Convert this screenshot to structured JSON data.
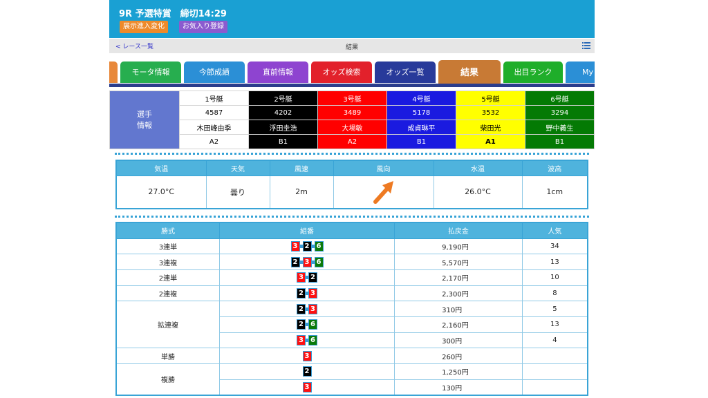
{
  "header": {
    "title": "9R 予選特賞　締切14:29",
    "btn_change": "展示進入変化",
    "btn_favorite": "お気入り登録"
  },
  "subheader": {
    "back": "< レース一覧",
    "center": "結果"
  },
  "tabs": [
    {
      "label": "",
      "color": "#e8883a"
    },
    {
      "label": "モータ情報",
      "color": "#27ae4f"
    },
    {
      "label": "今節成績",
      "color": "#2b8fd6"
    },
    {
      "label": "直前情報",
      "color": "#8e44d0"
    },
    {
      "label": "オッズ検索",
      "color": "#e2212b"
    },
    {
      "label": "オッズ一覧",
      "color": "#283a9a"
    },
    {
      "label": "結果",
      "color": "#c87a35"
    },
    {
      "label": "出目ランク",
      "color": "#1fae2a"
    },
    {
      "label": "My",
      "color": "#2b8fd6"
    }
  ],
  "players": {
    "label": "選手\n情報",
    "columns": [
      {
        "boat": "1号艇",
        "reg": "4587",
        "name": "木田峰由季",
        "class": "A2",
        "bg": "#ffffff",
        "fg": "#000000"
      },
      {
        "boat": "2号艇",
        "reg": "4202",
        "name": "浮田圭浩",
        "class": "B1",
        "bg": "#000000",
        "fg": "#ffffff"
      },
      {
        "boat": "3号艇",
        "reg": "3489",
        "name": "大場敏",
        "class": "A2",
        "bg": "#ff0000",
        "fg": "#ffffff"
      },
      {
        "boat": "4号艇",
        "reg": "5178",
        "name": "成貞琳平",
        "class": "B1",
        "bg": "#1a1ae0",
        "fg": "#ffffff"
      },
      {
        "boat": "5号艇",
        "reg": "3532",
        "name": "柴田光",
        "class": "A1",
        "bg": "#ffff00",
        "fg": "#000000"
      },
      {
        "boat": "6号艇",
        "reg": "3294",
        "name": "野中義生",
        "class": "B1",
        "bg": "#047a04",
        "fg": "#ffffff"
      }
    ]
  },
  "weather": {
    "headers": [
      "気温",
      "天気",
      "風速",
      "風向",
      "水温",
      "波高"
    ],
    "values": [
      "27.0°C",
      "曇り",
      "2m",
      "",
      "26.0°C",
      "1cm"
    ]
  },
  "results": {
    "headers": [
      "勝式",
      "組番",
      "払戻金",
      "人気"
    ],
    "rows": [
      {
        "type": "3連単",
        "combo": [
          3,
          2,
          6
        ],
        "payout": "9,190円",
        "pop": "34"
      },
      {
        "type": "3連複",
        "combo": [
          2,
          3,
          6
        ],
        "payout": "5,570円",
        "pop": "13"
      },
      {
        "type": "2連単",
        "combo": [
          3,
          2
        ],
        "payout": "2,170円",
        "pop": "10"
      },
      {
        "type": "2連複",
        "combo": [
          2,
          3
        ],
        "payout": "2,300円",
        "pop": "8"
      },
      {
        "type": "拡連複",
        "combo": [
          2,
          3
        ],
        "payout": "310円",
        "pop": "5"
      },
      {
        "type": "",
        "combo": [
          2,
          6
        ],
        "payout": "2,160円",
        "pop": "13"
      },
      {
        "type": "",
        "combo": [
          3,
          6
        ],
        "payout": "300円",
        "pop": "4"
      },
      {
        "type": "単勝",
        "combo": [
          3
        ],
        "payout": "260円",
        "pop": ""
      },
      {
        "type": "複勝",
        "combo": [
          2
        ],
        "payout": "1,250円",
        "pop": ""
      },
      {
        "type": "",
        "combo": [
          3
        ],
        "payout": "130円",
        "pop": ""
      }
    ]
  }
}
